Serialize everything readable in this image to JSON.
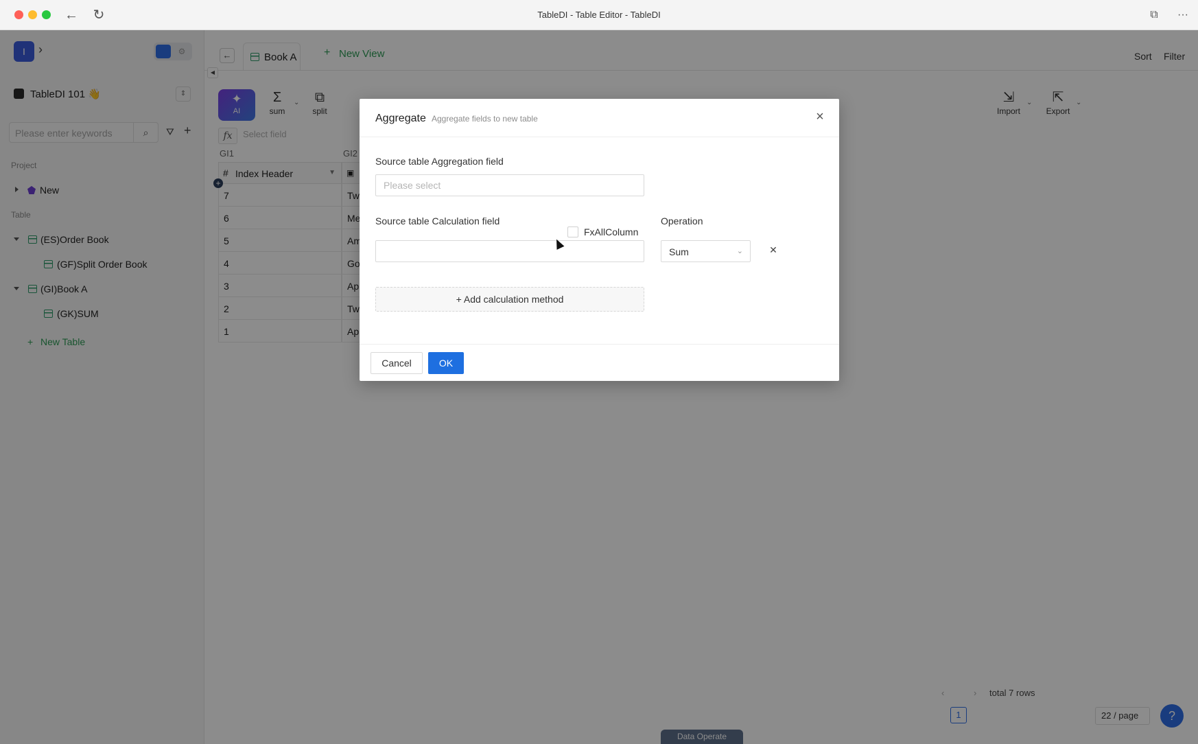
{
  "window": {
    "title": "TableDI - Table Editor - TableDI"
  },
  "sidebar": {
    "workspace_initial": "I",
    "project_name": "TableDI 101 👋",
    "search": {
      "placeholder": "Please enter keywords",
      "value": ""
    },
    "project_section": "Project",
    "project_item": "New",
    "table_section": "Table",
    "tables": [
      {
        "label": "(ES)Order Book"
      },
      {
        "label": "(GF)Split Order Book"
      },
      {
        "label": "(GI)Book A"
      },
      {
        "label": "(GK)SUM"
      }
    ],
    "new_table": "New Table"
  },
  "tabs": {
    "active": "Book A",
    "new_view": "New View"
  },
  "top_right": {
    "sort": "Sort",
    "filter": "Filter"
  },
  "toolbar": {
    "ai": "AI",
    "sum": "sum",
    "split": "split",
    "import": "Import",
    "export": "Export"
  },
  "formula": {
    "placeholder": "Select field"
  },
  "grid": {
    "col_codes": [
      "GI1",
      "GI2"
    ],
    "index_header": "Index Header",
    "rows": [
      {
        "index": "7",
        "text": "Tw"
      },
      {
        "index": "6",
        "text": "Me"
      },
      {
        "index": "5",
        "text": "Am"
      },
      {
        "index": "4",
        "text": "Go"
      },
      {
        "index": "3",
        "text": "Ap"
      },
      {
        "index": "2",
        "text": "Tw"
      },
      {
        "index": "1",
        "text": "Ap"
      }
    ]
  },
  "pager": {
    "total": "total 7 rows",
    "page": "1",
    "page_size": "22 / page"
  },
  "data_operate": "Data Operate",
  "modal": {
    "title": "Aggregate",
    "subtitle": "Aggregate fields to new table",
    "agg_label": "Source table Aggregation field",
    "agg_placeholder": "Please select",
    "calc_label": "Source table Calculation field",
    "fx_all_column": "FxAllColumn",
    "operation_label": "Operation",
    "operation_value": "Sum",
    "add_method": "+ Add calculation method",
    "cancel": "Cancel",
    "ok": "OK"
  }
}
